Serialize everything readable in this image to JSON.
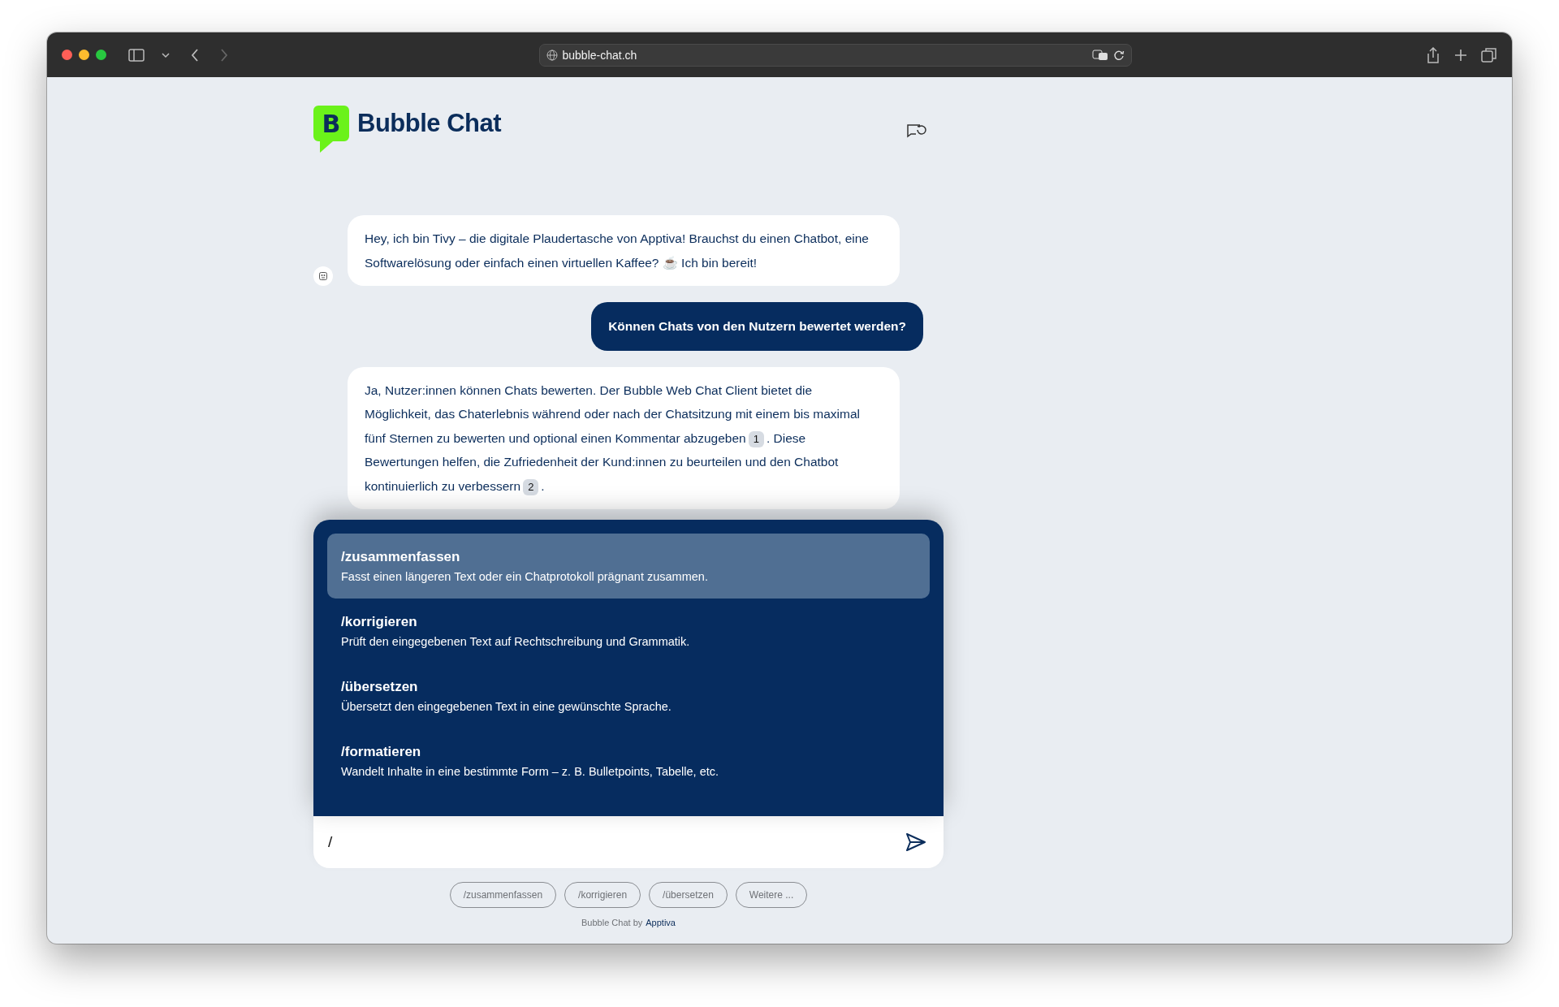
{
  "browser": {
    "url": "bubble-chat.ch"
  },
  "header": {
    "brand": "Bubble Chat",
    "logo_letter": "B"
  },
  "messages": [
    {
      "kind": "bot",
      "segments": [
        {
          "kind": "text",
          "text": "Hey, ich bin Tivy – die digitale Plaudertasche von Apptiva! Brauchst du einen Chatbot, eine Softwarelösung oder einfach einen virtuellen Kaffee? ☕ Ich bin bereit!"
        }
      ]
    },
    {
      "kind": "user",
      "segments": [
        {
          "kind": "text",
          "text": "Können Chats von den Nutzern bewertet werden?"
        }
      ]
    },
    {
      "kind": "bot",
      "segments": [
        {
          "kind": "text",
          "text": "Ja, Nutzer:innen können Chats bewerten. Der Bubble Web Chat Client bietet die Möglichkeit, das Chaterlebnis während oder nach der Chatsitzung mit einem bis maximal fünf Sternen zu bewerten und optional einen Kommentar abzugeben"
        },
        {
          "kind": "cite",
          "text": "1"
        },
        {
          "kind": "text",
          "text": ". Diese Bewertungen helfen, die Zufriedenheit der Kund:innen zu beurteilen und den Chatbot kontinuierlich zu verbessern"
        },
        {
          "kind": "cite",
          "text": "2"
        },
        {
          "kind": "text",
          "text": "."
        }
      ]
    }
  ],
  "command_menu": [
    {
      "command": "/zusammenfassen",
      "description": "Fasst einen längeren Text oder ein Chatprotokoll prägnant zusammen.",
      "selected": true
    },
    {
      "command": "/korrigieren",
      "description": "Prüft den eingegebenen Text auf Rechtschreibung und Grammatik.",
      "selected": false
    },
    {
      "command": "/übersetzen",
      "description": "Übersetzt den eingegebenen Text in eine gewünschte Sprache.",
      "selected": false
    },
    {
      "command": "/formatieren",
      "description": "Wandelt Inhalte in eine bestimmte Form – z. B. Bulletpoints, Tabelle, etc.",
      "selected": false
    }
  ],
  "input": {
    "value": "/"
  },
  "quick_commands": [
    "/zusammenfassen",
    "/korrigieren",
    "/übersetzen",
    "Weitere ..."
  ],
  "footer": {
    "text": "Bubble Chat by",
    "link": "Apptiva"
  }
}
